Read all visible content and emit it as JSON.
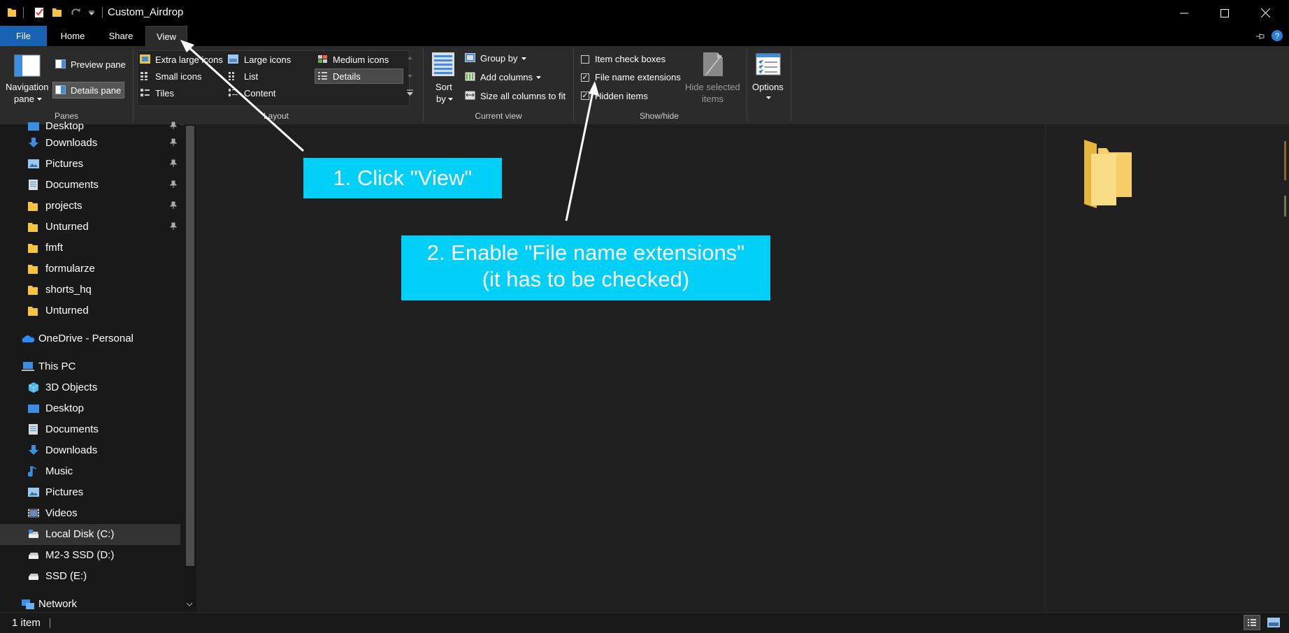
{
  "window": {
    "title": "Custom_Airdrop"
  },
  "tabs": {
    "file": "File",
    "home": "Home",
    "share": "Share",
    "view": "View"
  },
  "ribbon": {
    "panes": {
      "navigation_pane_1": "Navigation",
      "navigation_pane_2": "pane",
      "preview_pane": "Preview pane",
      "details_pane": "Details pane",
      "group_label": "Panes"
    },
    "layout": {
      "extra_large_icons": "Extra large icons",
      "large_icons": "Large icons",
      "medium_icons": "Medium icons",
      "small_icons": "Small icons",
      "list": "List",
      "details": "Details",
      "tiles": "Tiles",
      "content": "Content",
      "group_label": "Layout"
    },
    "current_view": {
      "sort_by_1": "Sort",
      "sort_by_2": "by",
      "group_by": "Group by",
      "add_columns": "Add columns",
      "size_all_columns": "Size all columns to fit",
      "group_label": "Current view"
    },
    "show_hide": {
      "item_check_boxes": "Item check boxes",
      "item_check_boxes_checked": false,
      "file_name_extensions": "File name extensions",
      "file_name_extensions_checked": true,
      "hidden_items": "Hidden items",
      "hidden_items_checked": true,
      "hide_selected_1": "Hide selected",
      "hide_selected_2": "items",
      "group_label": "Show/hide"
    },
    "options": {
      "label": "Options"
    }
  },
  "nav": {
    "quick_access": [
      {
        "label": "Desktop",
        "icon": "desktop-icon",
        "pinned": true
      },
      {
        "label": "Downloads",
        "icon": "download-icon",
        "pinned": true
      },
      {
        "label": "Pictures",
        "icon": "pictures-icon",
        "pinned": true
      },
      {
        "label": "Documents",
        "icon": "documents-icon",
        "pinned": true
      },
      {
        "label": "projects",
        "icon": "folder-icon",
        "pinned": true
      },
      {
        "label": "Unturned",
        "icon": "folder-icon",
        "pinned": true
      },
      {
        "label": "fmft",
        "icon": "folder-icon",
        "pinned": false
      },
      {
        "label": "formularze",
        "icon": "folder-icon",
        "pinned": false
      },
      {
        "label": "shorts_hq",
        "icon": "folder-icon",
        "pinned": false
      },
      {
        "label": "Unturned",
        "icon": "folder-icon",
        "pinned": false
      }
    ],
    "onedrive": "OneDrive - Personal",
    "this_pc": "This PC",
    "pc_items": [
      {
        "label": "3D Objects",
        "icon": "3d-objects-icon"
      },
      {
        "label": "Desktop",
        "icon": "desktop-icon"
      },
      {
        "label": "Documents",
        "icon": "documents-icon"
      },
      {
        "label": "Downloads",
        "icon": "download-icon"
      },
      {
        "label": "Music",
        "icon": "music-icon"
      },
      {
        "label": "Pictures",
        "icon": "pictures-icon"
      },
      {
        "label": "Videos",
        "icon": "videos-icon"
      },
      {
        "label": "Local Disk (C:)",
        "icon": "drive-icon",
        "selected": true
      },
      {
        "label": "M2-3 SSD (D:)",
        "icon": "drive-icon"
      },
      {
        "label": "SSD (E:)",
        "icon": "drive-icon"
      }
    ],
    "network": "Network"
  },
  "status": {
    "item_count": "1 item"
  },
  "callouts": {
    "step1": "1. Click \"View\"",
    "step2_line1": "2. Enable \"File name extensions\"",
    "step2_line2": "(it has to be checked)"
  },
  "colors": {
    "accent_file_tab": "#1a62b4",
    "callout": "#00cff7",
    "folder": "#f5c542"
  }
}
